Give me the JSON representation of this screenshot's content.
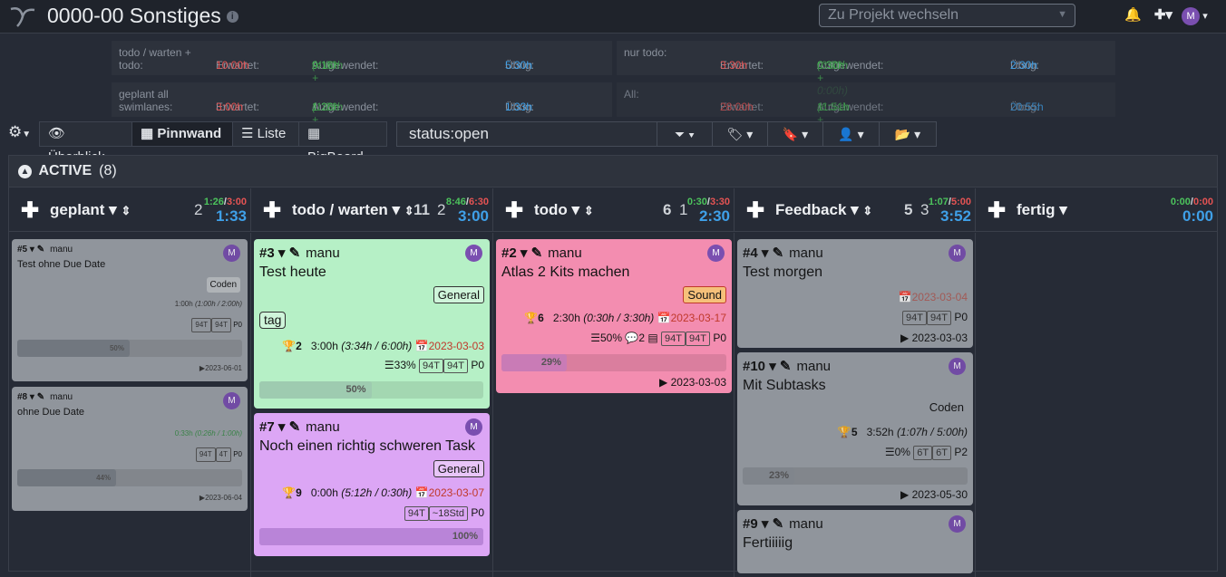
{
  "header": {
    "project_title": "0000-00 Sonstiges",
    "project_select_placeholder": "Zu Projekt wechseln",
    "user_initial": "M"
  },
  "stats": {
    "row1_left": {
      "label": "todo / warten + todo:",
      "expected_label": "Erwartet:",
      "expected": "10:00h",
      "spent_label": "Aufgewendet:",
      "spent": "9:16h",
      "spent_detail": "(4:00h + 5:16h)",
      "remain_label": "Übrig:",
      "remain": "5:30h"
    },
    "row1_right": {
      "label": "nur todo:",
      "expected_label": "Erwartet:",
      "expected": "3:30h",
      "spent_label": "Aufgewendet:",
      "spent": "0:30h",
      "spent_detail": "(0:30h + 0:00h)",
      "remain_label": "Übrig:",
      "remain": "2:30h"
    },
    "row2_left": {
      "label": "geplant all swimlanes:",
      "expected_label": "Erwartet:",
      "expected": "3:00h",
      "spent_label": "Aufgewendet:",
      "spent": "1:26h",
      "spent_detail": "(1:26h + 0:00h)",
      "remain_label": "Übrig:",
      "remain": "1:33h"
    },
    "row2_right": {
      "label": "All:",
      "expected_label": "Erwartet:",
      "expected": "28:00h",
      "spent_label": "Aufgewendet:",
      "spent": "11:51h",
      "spent_detail": "(6:34h + 5:16h)",
      "remain_label": "Übrig:",
      "remain": "20:55h"
    }
  },
  "toolbar": {
    "overview": "Überblick",
    "board": "Pinnwand",
    "list": "Liste",
    "bigboard": "BigBoard",
    "search_value": "status:open"
  },
  "swimlane": {
    "name": "ACTIVE",
    "count": "(8)"
  },
  "columns": [
    {
      "name": "geplant",
      "count": "",
      "tasks": "2",
      "time_a": "1:26",
      "time_b": "3:00",
      "remaining": "1:33"
    },
    {
      "name": "todo / warten",
      "count": "11",
      "tasks": "2",
      "time_a": "8:46",
      "time_b": "6:30",
      "remaining": "3:00"
    },
    {
      "name": "todo",
      "count": "6",
      "tasks": "1",
      "time_a": "0:30",
      "time_b": "3:30",
      "remaining": "2:30"
    },
    {
      "name": "Feedback",
      "count": "5",
      "tasks": "3",
      "time_a": "1:07",
      "time_b": "5:00",
      "remaining": "3:52"
    },
    {
      "name": "fertig",
      "count": "",
      "tasks": "",
      "time_a": "0:00",
      "time_b": "0:00",
      "remaining": "0:00"
    }
  ],
  "cards": {
    "c5": {
      "id": "#5",
      "user": "manu",
      "title": "Test ohne Due Date",
      "label": "Coden",
      "time": "1:00h",
      "time_detail": "(1:00h / 2:00h)",
      "chip1": "94T",
      "chip2": "94T",
      "prio": "P0",
      "progress": 50,
      "progress_text": "50%",
      "start": "2023-06-01"
    },
    "c8": {
      "id": "#8",
      "user": "manu",
      "title": "ohne Due Date",
      "time": "0:33h",
      "time_detail": "(0:26h / 1:00h)",
      "chip1": "94T",
      "chip2": "4T",
      "prio": "P0",
      "progress": 44,
      "progress_text": "44%",
      "start": "2023-06-04"
    },
    "c3": {
      "id": "#3",
      "user": "manu",
      "title": "Test heute",
      "label": "General",
      "tag": "tag",
      "score": "2",
      "time": "3:00h",
      "time_detail": "(3:34h / 6:00h)",
      "due": "2023-03-03",
      "pct": "33%",
      "chip1": "94T",
      "chip2": "94T",
      "prio": "P0",
      "progress": 50,
      "progress_text": "50%"
    },
    "c7": {
      "id": "#7",
      "user": "manu",
      "title": "Noch einen richtig schweren Task",
      "label": "General",
      "score": "9",
      "time": "0:00h",
      "time_detail": "(5:12h / 0:30h)",
      "due": "2023-03-07",
      "chip1": "94T",
      "chip2": "~18Std",
      "prio": "P0",
      "progress": 100,
      "progress_text": "100%"
    },
    "c2": {
      "id": "#2",
      "user": "manu",
      "title": "Atlas 2 Kits machen",
      "label": "Sound",
      "score": "6",
      "time": "2:30h",
      "time_detail": "(0:30h / 3:30h)",
      "due": "2023-03-17",
      "pct": "50%",
      "comments": "2",
      "chip1": "94T",
      "chip2": "94T",
      "prio": "P0",
      "progress": 29,
      "progress_text": "29%",
      "start": "2023-03-03"
    },
    "c4": {
      "id": "#4",
      "user": "manu",
      "title": "Test morgen",
      "due": "2023-03-04",
      "chip1": "94T",
      "chip2": "94T",
      "prio": "P0",
      "start": "2023-03-03"
    },
    "c10": {
      "id": "#10",
      "user": "manu",
      "title": "Mit Subtasks",
      "label": "Coden",
      "score": "5",
      "time": "3:52h",
      "time_detail": "(1:07h / 5:00h)",
      "pct": "0%",
      "chip1": "6T",
      "chip2": "6T",
      "prio": "P2",
      "progress": 23,
      "progress_text": "23%",
      "start": "2023-05-30"
    },
    "c9": {
      "id": "#9",
      "user": "manu",
      "title": "Fertiiiiig"
    }
  },
  "colors": {
    "green_card": "#b6f0c6",
    "purple_card": "#dca6f5",
    "pink_card": "#f38db0",
    "grey_card": "#a9aeb5",
    "accent_blue": "#3fa0e8"
  }
}
